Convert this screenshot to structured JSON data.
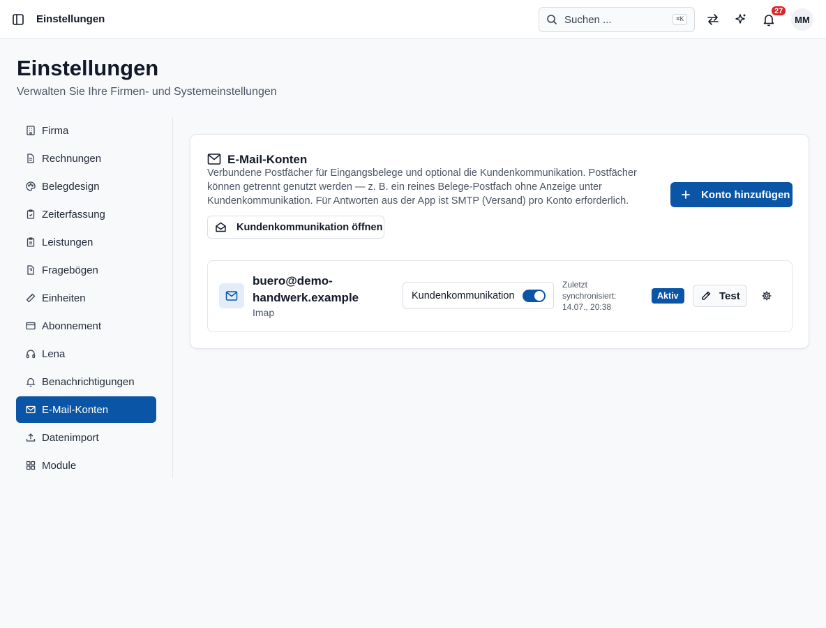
{
  "topbar": {
    "title": "Einstellungen",
    "search_placeholder": "Suchen ...",
    "search_shortcut": "⌘K",
    "notification_count": "27",
    "avatar_initials": "MM"
  },
  "page": {
    "title": "Einstellungen",
    "subtitle": "Verwalten Sie Ihre Firmen- und Systemeinstellungen"
  },
  "sidebar": {
    "items": [
      {
        "label": "Firma",
        "icon": "building-icon"
      },
      {
        "label": "Rechnungen",
        "icon": "file-text-icon"
      },
      {
        "label": "Belegdesign",
        "icon": "palette-icon"
      },
      {
        "label": "Zeiterfassung",
        "icon": "clipboard-clock-icon"
      },
      {
        "label": "Leistungen",
        "icon": "clipboard-list-icon"
      },
      {
        "label": "Fragebögen",
        "icon": "file-question-icon"
      },
      {
        "label": "Einheiten",
        "icon": "ruler-icon"
      },
      {
        "label": "Abonnement",
        "icon": "credit-card-icon"
      },
      {
        "label": "Lena",
        "icon": "headphones-icon"
      },
      {
        "label": "Benachrichtigungen",
        "icon": "bell-icon"
      },
      {
        "label": "E-Mail-Konten",
        "icon": "mail-icon",
        "active": true
      },
      {
        "label": "Datenimport",
        "icon": "upload-icon"
      },
      {
        "label": "Module",
        "icon": "grid-icon"
      }
    ]
  },
  "card": {
    "title": "E-Mail-Konten",
    "description": "Verbundene Postfächer für Eingangsbelege und optional die Kundenkommunikation. Postfächer können getrennt genutzt werden — z. B. ein reines Belege-Postfach ohne Anzeige unter Kundenkommunikation. Für Antworten aus der App ist SMTP (Versand) pro Konto erforderlich.",
    "open_button": "Kundenkommunikation öffnen",
    "add_button": "Konto hinzufügen"
  },
  "account": {
    "email": "buero@demo-handwerk.example",
    "type": "Imap",
    "toggle_label": "Kundenkommunikation",
    "toggle_on": true,
    "sync_label": "Zuletzt synchronisiert: 14.07., 20:38",
    "status": "Aktiv",
    "test_button": "Test"
  },
  "colors": {
    "accent": "#0b55a6",
    "badge": "#dc2626",
    "background": "#f8f9fb"
  }
}
